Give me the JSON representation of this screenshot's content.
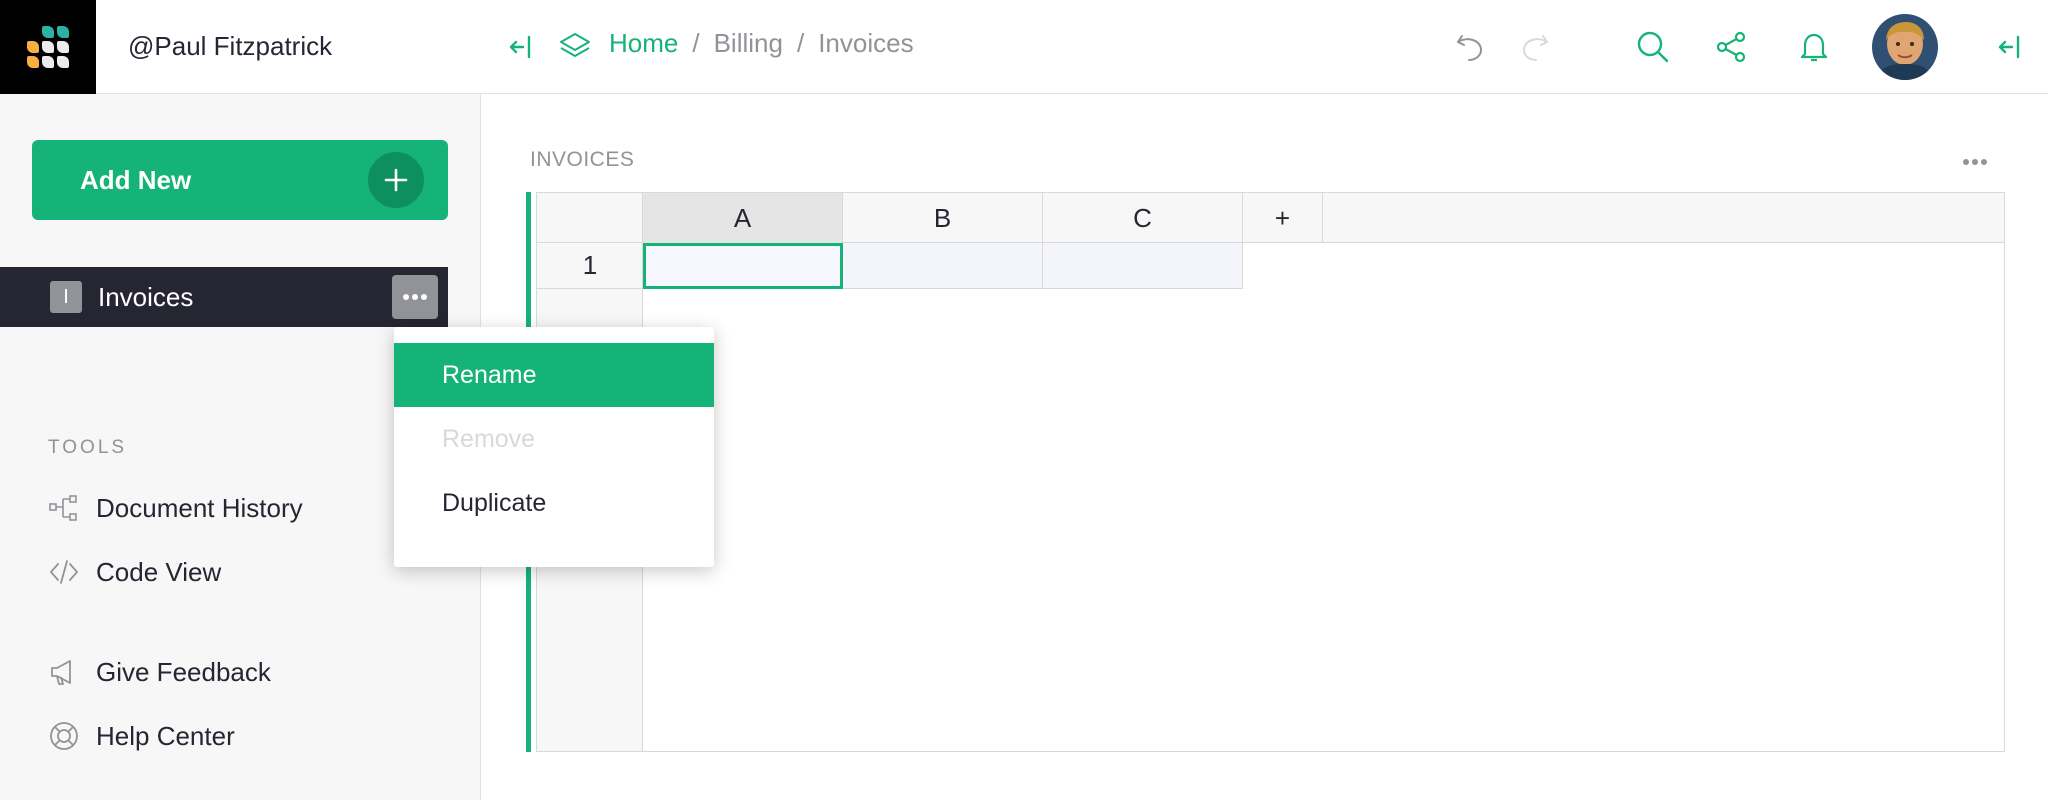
{
  "user": {
    "name": "@Paul Fitzpatrick"
  },
  "left_panel": {
    "add_new_label": "Add New",
    "pages": [
      {
        "initial": "I",
        "label": "Invoices"
      }
    ],
    "tools_header": "TOOLS",
    "tools": [
      {
        "label": "Document History",
        "icon": "document-history-icon"
      },
      {
        "label": "Code View",
        "icon": "code-icon"
      }
    ],
    "bottom": [
      {
        "label": "Give Feedback",
        "icon": "megaphone-icon"
      },
      {
        "label": "Help Center",
        "icon": "lifebuoy-icon"
      }
    ]
  },
  "breadcrumb": {
    "home": "Home",
    "sep1": "/",
    "folder": "Billing",
    "sep2": "/",
    "page": "Invoices"
  },
  "section": {
    "title": "INVOICES",
    "columns": [
      "A",
      "B",
      "C"
    ],
    "add_column_label": "+",
    "rows": [
      "1"
    ]
  },
  "context_menu": {
    "items": [
      {
        "label": "Rename",
        "state": "active"
      },
      {
        "label": "Remove",
        "state": "disabled"
      },
      {
        "label": "Duplicate",
        "state": "normal"
      }
    ]
  },
  "colors": {
    "accent": "#16b378",
    "dark_selection": "#262633",
    "muted_text": "#929299"
  },
  "logo_colors": [
    "#2bb2a4",
    "#2bb2a4",
    "#2bb2a4",
    "#f9ae41",
    "#ececec",
    "#ececec",
    "#f9ae41",
    "#ececec",
    "#ececec"
  ]
}
